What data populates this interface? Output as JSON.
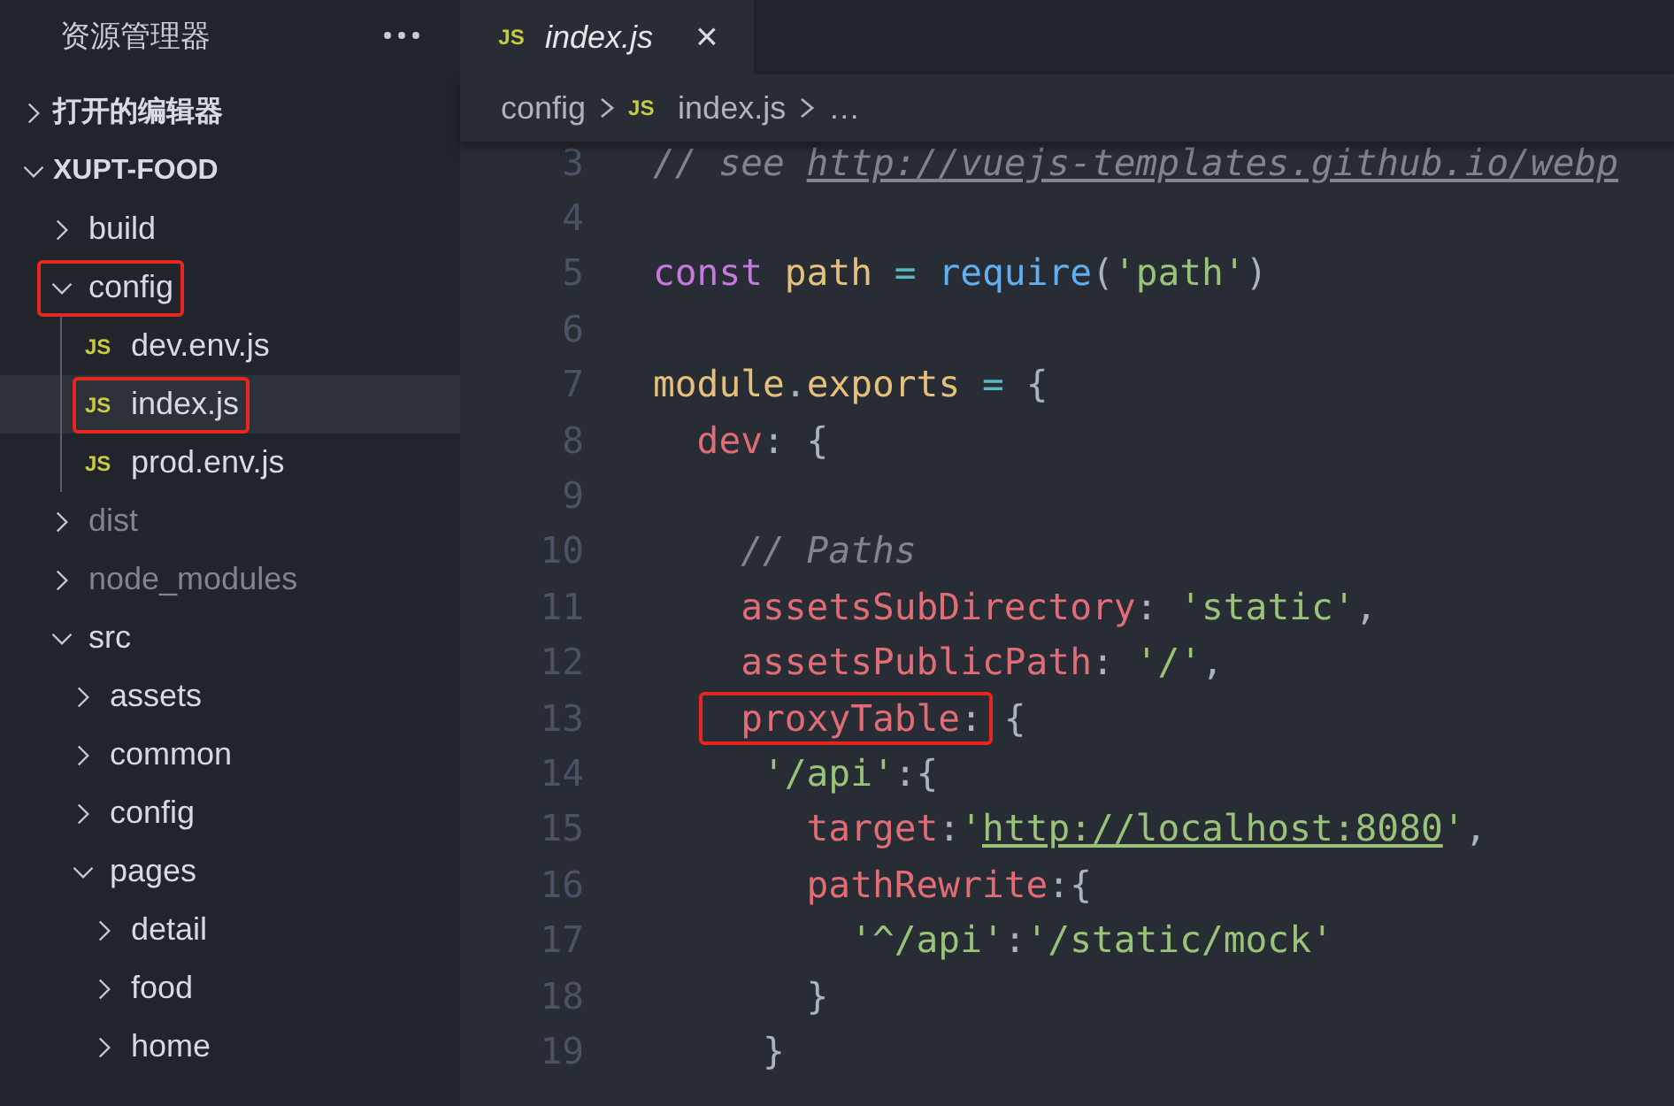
{
  "sidebar": {
    "title": "资源管理器",
    "sections": [
      {
        "label": "打开的编辑器",
        "expanded": false
      },
      {
        "label": "XUPT-FOOD",
        "expanded": true,
        "tree": [
          {
            "label": "build",
            "kind": "folder",
            "expanded": false,
            "dimmed": false,
            "highlighted": false,
            "selected": false
          },
          {
            "label": "config",
            "kind": "folder",
            "expanded": true,
            "dimmed": false,
            "highlighted": true,
            "selected": false,
            "children": [
              {
                "label": "dev.env.js",
                "kind": "file",
                "badge": "JS",
                "dimmed": false,
                "highlighted": false,
                "selected": false
              },
              {
                "label": "index.js",
                "kind": "file",
                "badge": "JS",
                "dimmed": false,
                "highlighted": true,
                "selected": true
              },
              {
                "label": "prod.env.js",
                "kind": "file",
                "badge": "JS",
                "dimmed": false,
                "highlighted": false,
                "selected": false
              }
            ]
          },
          {
            "label": "dist",
            "kind": "folder",
            "expanded": false,
            "dimmed": true,
            "highlighted": false,
            "selected": false
          },
          {
            "label": "node_modules",
            "kind": "folder",
            "expanded": false,
            "dimmed": true,
            "highlighted": false,
            "selected": false
          },
          {
            "label": "src",
            "kind": "folder",
            "expanded": true,
            "dimmed": false,
            "highlighted": false,
            "selected": false,
            "children": [
              {
                "label": "assets",
                "kind": "folder",
                "expanded": false,
                "dimmed": false,
                "highlighted": false,
                "selected": false
              },
              {
                "label": "common",
                "kind": "folder",
                "expanded": false,
                "dimmed": false,
                "highlighted": false,
                "selected": false
              },
              {
                "label": "config",
                "kind": "folder",
                "expanded": false,
                "dimmed": false,
                "highlighted": false,
                "selected": false
              },
              {
                "label": "pages",
                "kind": "folder",
                "expanded": true,
                "dimmed": false,
                "highlighted": false,
                "selected": false,
                "children": [
                  {
                    "label": "detail",
                    "kind": "folder",
                    "expanded": false,
                    "dimmed": false,
                    "highlighted": false,
                    "selected": false
                  },
                  {
                    "label": "food",
                    "kind": "folder",
                    "expanded": false,
                    "dimmed": false,
                    "highlighted": false,
                    "selected": false
                  },
                  {
                    "label": "home",
                    "kind": "folder",
                    "expanded": false,
                    "dimmed": false,
                    "highlighted": false,
                    "selected": false
                  }
                ]
              }
            ]
          }
        ]
      }
    ]
  },
  "tabs": [
    {
      "badge": "JS",
      "label": "index.js",
      "preview": true,
      "selected": true,
      "close": "×"
    }
  ],
  "breadcrumb": [
    {
      "label": "config"
    },
    {
      "badge": "JS",
      "label": "index.js"
    },
    {
      "label": "…"
    }
  ],
  "editor": {
    "lines": [
      {
        "number": "3",
        "tokens": [
          {
            "kind": "comment",
            "text": "// see ",
            "boxed": false
          },
          {
            "kind": "comment_link",
            "text": "http://vuejs-templates.github.io/webp",
            "boxed": false
          }
        ]
      },
      {
        "number": "4"
      },
      {
        "number": "5",
        "tokens": [
          {
            "kind": "keyword",
            "text": "const ",
            "boxed": false
          },
          {
            "kind": "variable",
            "text": "path ",
            "boxed": false
          },
          {
            "kind": "operator",
            "text": "= ",
            "boxed": false
          },
          {
            "kind": "function",
            "text": "require",
            "boxed": false
          },
          {
            "kind": "punct",
            "text": "(",
            "boxed": false
          },
          {
            "kind": "string",
            "text": "'path'",
            "boxed": false
          },
          {
            "kind": "punct",
            "text": ")",
            "boxed": false
          }
        ]
      },
      {
        "number": "6"
      },
      {
        "number": "7",
        "tokens": [
          {
            "kind": "variable",
            "text": "module",
            "boxed": false
          },
          {
            "kind": "punct",
            "text": ".",
            "boxed": false
          },
          {
            "kind": "variable",
            "text": "exports ",
            "boxed": false
          },
          {
            "kind": "operator",
            "text": "= ",
            "boxed": false
          },
          {
            "kind": "punct",
            "text": "{",
            "boxed": false
          }
        ],
        "children": [
          {
            "number": "8",
            "tokens": [
              {
                "kind": "property",
                "text": "dev",
                "boxed": false
              },
              {
                "kind": "punct",
                "text": ": {",
                "boxed": false
              }
            ],
            "children": [
              {
                "number": "9"
              },
              {
                "number": "10",
                "tokens": [
                  {
                    "kind": "comment",
                    "text": "// Paths",
                    "boxed": false
                  }
                ]
              },
              {
                "number": "11",
                "tokens": [
                  {
                    "kind": "property",
                    "text": "assetsSubDirectory",
                    "boxed": false
                  },
                  {
                    "kind": "punct",
                    "text": ": ",
                    "boxed": false
                  },
                  {
                    "kind": "string",
                    "text": "'static'",
                    "boxed": false
                  },
                  {
                    "kind": "punct",
                    "text": ",",
                    "boxed": false
                  }
                ]
              },
              {
                "number": "12",
                "tokens": [
                  {
                    "kind": "property",
                    "text": "assetsPublicPath",
                    "boxed": false
                  },
                  {
                    "kind": "punct",
                    "text": ": ",
                    "boxed": false
                  },
                  {
                    "kind": "string",
                    "text": "'/'",
                    "boxed": false
                  },
                  {
                    "kind": "punct",
                    "text": ",",
                    "boxed": false
                  }
                ]
              },
              {
                "number": "13",
                "tokens": [
                  {
                    "kind": "property",
                    "text": "proxyTable",
                    "boxed": true
                  },
                  {
                    "kind": "punct",
                    "text": ":",
                    "boxed": true
                  },
                  {
                    "kind": "punct",
                    "text": " {",
                    "boxed": false
                  }
                ],
                "children": [
                  {
                    "number": "14",
                    "tokens": [
                      {
                        "kind": "string",
                        "text": "'/api'",
                        "boxed": false
                      },
                      {
                        "kind": "punct",
                        "text": ":{",
                        "boxed": false
                      }
                    ],
                    "children": [
                      {
                        "number": "15",
                        "tokens": [
                          {
                            "kind": "property",
                            "text": "target",
                            "boxed": false
                          },
                          {
                            "kind": "punct",
                            "text": ":",
                            "boxed": false
                          },
                          {
                            "kind": "string",
                            "text": "'",
                            "boxed": false
                          },
                          {
                            "kind": "url",
                            "text": "http://localhost:8080",
                            "boxed": false
                          },
                          {
                            "kind": "string",
                            "text": "'",
                            "boxed": false
                          },
                          {
                            "kind": "punct",
                            "text": ",",
                            "boxed": false
                          }
                        ]
                      },
                      {
                        "number": "16",
                        "tokens": [
                          {
                            "kind": "property",
                            "text": "pathRewrite",
                            "boxed": false
                          },
                          {
                            "kind": "punct",
                            "text": ":{",
                            "boxed": false
                          }
                        ],
                        "children": [
                          {
                            "number": "17",
                            "tokens": [
                              {
                                "kind": "string",
                                "text": "'^/api'",
                                "boxed": false
                              },
                              {
                                "kind": "punct",
                                "text": ":",
                                "boxed": false
                              },
                              {
                                "kind": "string",
                                "text": "'/static/mock'",
                                "boxed": false
                              }
                            ]
                          }
                        ]
                      },
                      {
                        "number": "18",
                        "tokens": [
                          {
                            "kind": "punct",
                            "text": "}",
                            "boxed": false
                          }
                        ]
                      }
                    ]
                  },
                  {
                    "number": "19",
                    "tokens": [
                      {
                        "kind": "punct",
                        "text": "}",
                        "boxed": false
                      }
                    ]
                  }
                ]
              }
            ]
          }
        ]
      }
    ]
  }
}
